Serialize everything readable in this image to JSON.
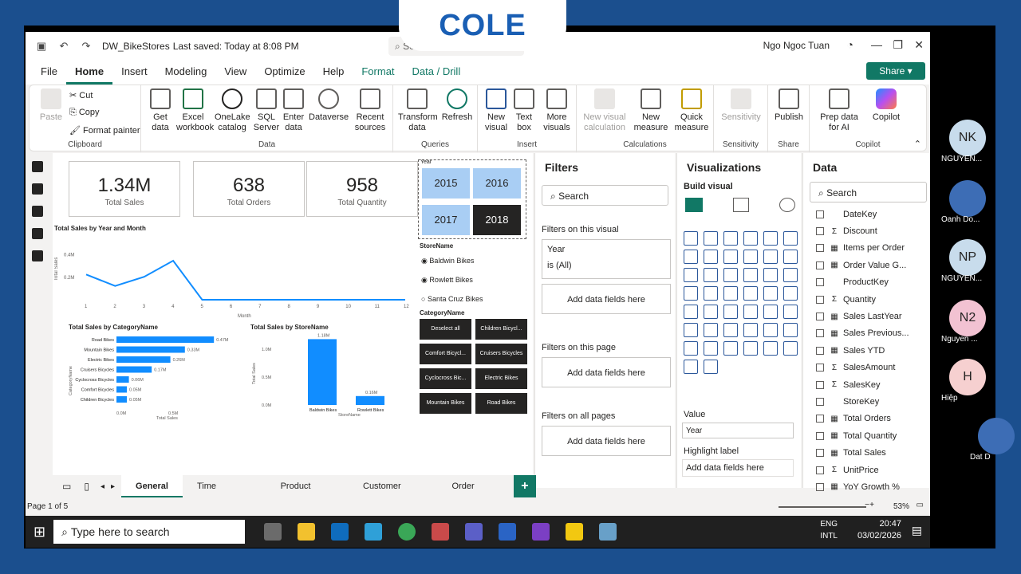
{
  "brand": "COLE",
  "title": {
    "file": "DW_BikeStores",
    "saved": "Last saved: Today at 8:08 PM",
    "search": "Sea",
    "user": "Ngo Ngoc Tuan"
  },
  "menu": [
    "File",
    "Home",
    "Insert",
    "Modeling",
    "View",
    "Optimize",
    "Help",
    "Format",
    "Data / Drill"
  ],
  "share": "Share",
  "ribbon": {
    "clipboard": {
      "paste": "Paste",
      "cut": "Cut",
      "copy": "Copy",
      "format_painter": "Format painter",
      "label": "Clipboard"
    },
    "data": {
      "get": "Get data",
      "excel": "Excel workbook",
      "onelake": "OneLake catalog",
      "sql": "SQL Server",
      "enter": "Enter data",
      "dataverse": "Dataverse",
      "recent": "Recent sources",
      "label": "Data"
    },
    "queries": {
      "transform": "Transform data",
      "refresh": "Refresh",
      "label": "Queries"
    },
    "insert": {
      "new_visual": "New visual",
      "text_box": "Text box",
      "more_visuals": "More visuals",
      "label": "Insert"
    },
    "calculations": {
      "new_visual_calc": "New visual calculation",
      "new_measure": "New measure",
      "quick_measure": "Quick measure",
      "label": "Calculations"
    },
    "sensitivity": {
      "btn": "Sensitivity",
      "label": "Sensitivity"
    },
    "share": {
      "publish": "Publish",
      "label": "Share"
    },
    "copilot": {
      "prep": "Prep data for AI",
      "copilot": "Copilot",
      "label": "Copilot"
    }
  },
  "cards": [
    {
      "value": "1.34M",
      "label": "Total Sales"
    },
    {
      "value": "638",
      "label": "Total Orders"
    },
    {
      "value": "958",
      "label": "Total Quantity"
    }
  ],
  "year_slicer": {
    "title": "Year",
    "years": [
      "2015",
      "2016",
      "2017",
      "2018"
    ],
    "selected": "2018"
  },
  "store_slicer": {
    "title": "StoreName",
    "stores": [
      "Baldwin Bikes",
      "Rowlett Bikes",
      "Santa Cruz Bikes"
    ]
  },
  "category_slicer": {
    "title": "CategoryName",
    "items": [
      "Deselect all",
      "Children Bicycl...",
      "Comfort Bicycl...",
      "Cruisers Bicycles",
      "Cyclocross Bic...",
      "Electric Bikes",
      "Mountain Bikes",
      "Road Bikes"
    ]
  },
  "charts": {
    "line_title": "Total Sales by Year and Month",
    "bar_title": "Total Sales by CategoryName",
    "col_title": "Total Sales by StoreName"
  },
  "chart_data": [
    {
      "type": "line",
      "title": "Total Sales by Year and Month",
      "xlabel": "Month",
      "ylabel": "Total Sales",
      "x": [
        1,
        2,
        3,
        4,
        5,
        6,
        7,
        8,
        9,
        10,
        11,
        12
      ],
      "values": [
        0.22,
        0.12,
        0.2,
        0.34,
        0.0,
        0.0,
        0.0,
        0.0,
        0.0,
        0.0,
        0.0,
        0.0
      ],
      "ylim": [
        0,
        0.5
      ]
    },
    {
      "type": "bar",
      "title": "Total Sales by CategoryName",
      "categories": [
        "Road Bikes",
        "Mountain Bikes",
        "Electric Bikes",
        "Cruisers Bicycles",
        "Cyclocross Bicycles",
        "Comfort Bicycles",
        "Children Bicycles"
      ],
      "values": [
        0.47,
        0.33,
        0.26,
        0.17,
        0.06,
        0.05,
        0.05
      ],
      "labels": [
        "0.47M",
        "0.33M",
        "0.26M",
        "0.17M",
        "0.06M",
        "0.05M",
        "0.05M"
      ],
      "xlabel": "Total Sales",
      "ylabel": "CategoryName"
    },
    {
      "type": "bar",
      "title": "Total Sales by StoreName",
      "categories": [
        "Baldwin Bikes",
        "Rowlett Bikes"
      ],
      "values": [
        1.18,
        0.16
      ],
      "labels": [
        "1.18M",
        "0.16M"
      ],
      "xlabel": "StoreName",
      "ylabel": "Total Sales",
      "ylim": [
        0,
        1.2
      ]
    }
  ],
  "filters": {
    "title": "Filters",
    "search": "Search",
    "on_visual": "Filters on this visual",
    "field": "Year",
    "field_state": "is (All)",
    "add": "Add data fields here",
    "on_page": "Filters on this page",
    "on_all": "Filters on all pages"
  },
  "viz": {
    "title": "Visualizations",
    "build": "Build visual",
    "value": "Value",
    "field": "Year",
    "highlight": "Highlight label",
    "add": "Add data fields here"
  },
  "data": {
    "title": "Data",
    "search": "Search",
    "fields": [
      {
        "name": "DateKey",
        "sym": ""
      },
      {
        "name": "Discount",
        "sym": "Σ"
      },
      {
        "name": "Items per Order",
        "sym": "▦"
      },
      {
        "name": "Order Value G...",
        "sym": "▦"
      },
      {
        "name": "ProductKey",
        "sym": ""
      },
      {
        "name": "Quantity",
        "sym": "Σ"
      },
      {
        "name": "Sales LastYear",
        "sym": "▦"
      },
      {
        "name": "Sales Previous...",
        "sym": "▦"
      },
      {
        "name": "Sales YTD",
        "sym": "▦"
      },
      {
        "name": "SalesAmount",
        "sym": "Σ"
      },
      {
        "name": "SalesKey",
        "sym": "Σ"
      },
      {
        "name": "StoreKey",
        "sym": ""
      },
      {
        "name": "Total Orders",
        "sym": "▦"
      },
      {
        "name": "Total Quantity",
        "sym": "▦"
      },
      {
        "name": "Total Sales",
        "sym": "▦"
      },
      {
        "name": "UnitPrice",
        "sym": "Σ"
      },
      {
        "name": "YoY Growth %",
        "sym": "▦"
      }
    ]
  },
  "tabs": [
    "General",
    "Time Intelligence",
    "Product Analysis",
    "Customer Analysis",
    "Order Analysis"
  ],
  "status": {
    "page": "Page 1 of 5",
    "zoom": "53%"
  },
  "taskbar": {
    "search": "Type here to search",
    "lang1": "ENG",
    "lang2": "INTL",
    "time": "20:47",
    "date": "03/02/2026"
  },
  "participants": [
    {
      "initials": "NK",
      "name": "NGUYEN...",
      "color": "#c8dcec"
    },
    {
      "initials": "",
      "name": "Oanh Do...",
      "color": "#3d6db5"
    },
    {
      "initials": "NP",
      "name": "NGUYEN...",
      "color": "#c8dcec"
    },
    {
      "initials": "N2",
      "name": "Nguyen ...",
      "color": "#f2c2d2"
    },
    {
      "initials": "H",
      "name": "Hiệp",
      "color": "#f6d0d0"
    },
    {
      "initials": "",
      "name": "Dat D",
      "color": "#3d6db5"
    }
  ]
}
